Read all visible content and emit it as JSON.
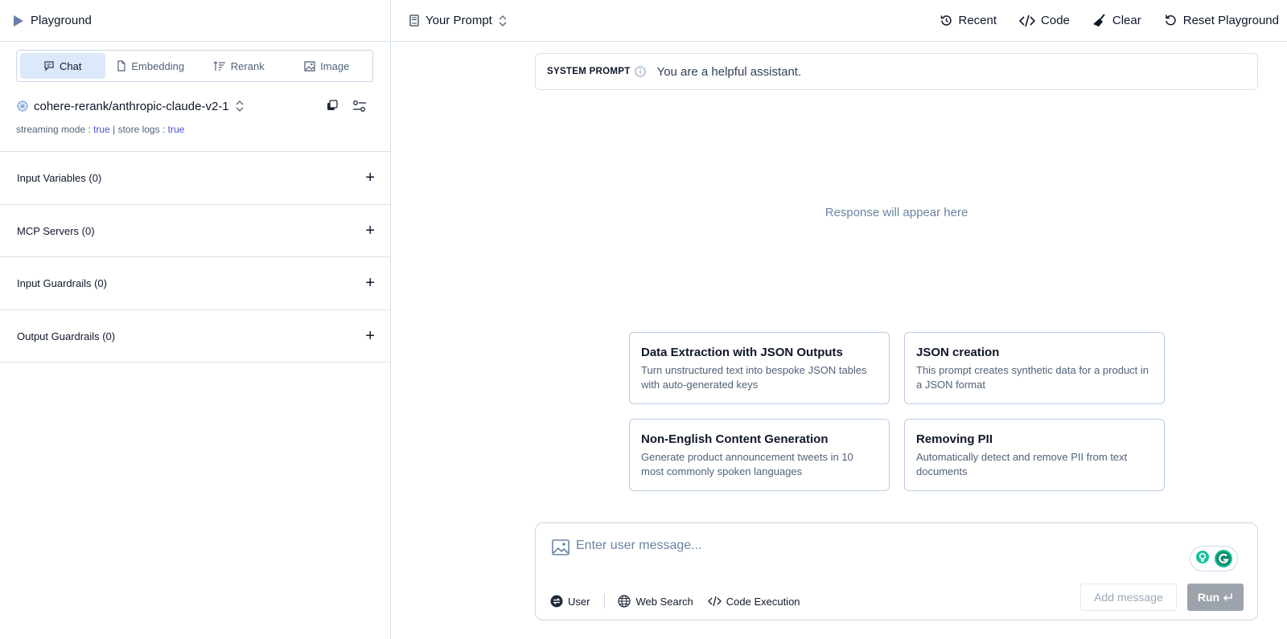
{
  "sidebar": {
    "title": "Playground",
    "tabs": [
      {
        "label": "Chat",
        "icon": "chat-icon",
        "active": true
      },
      {
        "label": "Embedding",
        "icon": "file-icon",
        "active": false
      },
      {
        "label": "Rerank",
        "icon": "sort-icon",
        "active": false
      },
      {
        "label": "Image",
        "icon": "image-icon",
        "active": false
      }
    ],
    "model": "cohere-rerank/anthropic-claude-v2-1",
    "meta": {
      "streaming_label": "streaming mode :",
      "streaming_value": "true",
      "separator": "|",
      "logs_label": "store logs :",
      "logs_value": "true"
    },
    "sections": [
      {
        "label": "Input Variables (0)"
      },
      {
        "label": "MCP Servers (0)"
      },
      {
        "label": "Input Guardrails (0)"
      },
      {
        "label": "Output Guardrails (0)"
      }
    ]
  },
  "topbar": {
    "prompt_label": "Your Prompt",
    "actions": {
      "recent": "Recent",
      "code": "Code",
      "clear": "Clear",
      "reset": "Reset Playground"
    }
  },
  "system_prompt": {
    "label": "SYSTEM PROMPT",
    "text": "You are a helpful assistant."
  },
  "response_placeholder": "Response will appear here",
  "cards": [
    {
      "title": "Data Extraction with JSON Outputs",
      "desc": "Turn unstructured text into bespoke JSON tables with auto-generated keys"
    },
    {
      "title": "JSON creation",
      "desc": "This prompt creates synthetic data for a product in a JSON format"
    },
    {
      "title": "Non-English Content Generation",
      "desc": "Generate product announcement tweets in 10 most commonly spoken languages"
    },
    {
      "title": "Removing PII",
      "desc": "Automatically detect and remove PII from text documents"
    }
  ],
  "composer": {
    "placeholder": "Enter user message...",
    "role": "User",
    "web_search": "Web Search",
    "code_execution": "Code Execution",
    "add_message": "Add message",
    "run": "Run"
  },
  "colors": {
    "accent_link": "#4a4fd6",
    "active_tab_bg": "#dbe9fb",
    "border": "#d6e2ee",
    "run_disabled": "#9ca3ab"
  }
}
